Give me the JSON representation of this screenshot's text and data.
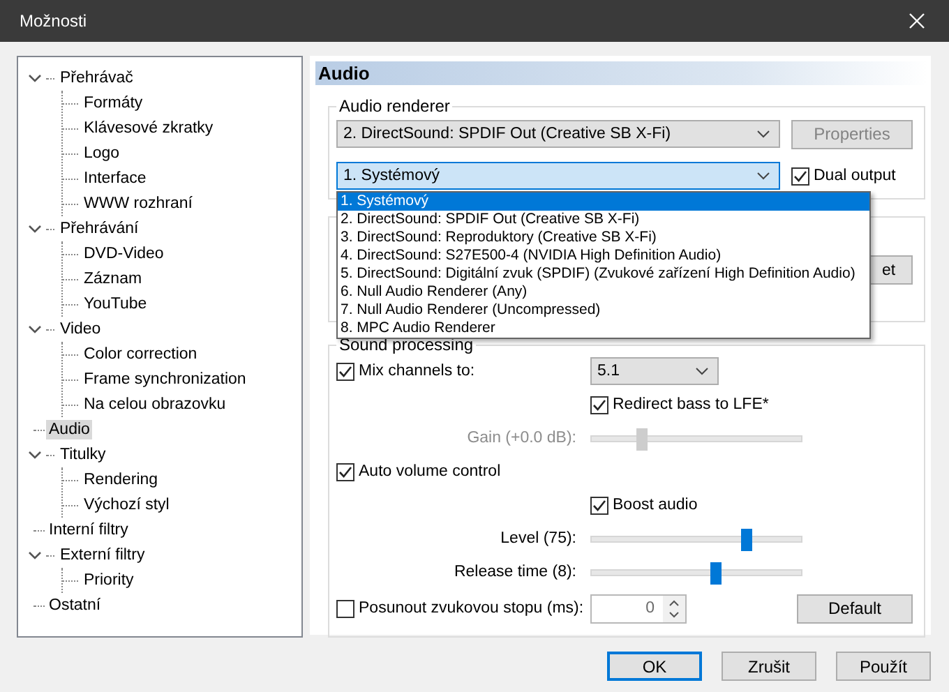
{
  "window": {
    "title": "Možnosti"
  },
  "sidebar": {
    "tree": [
      {
        "label": "Přehrávač",
        "expanded": true,
        "selected": false,
        "children": [
          {
            "label": "Formáty",
            "selected": false
          },
          {
            "label": "Klávesové zkratky",
            "selected": false
          },
          {
            "label": "Logo",
            "selected": false
          },
          {
            "label": "Interface",
            "selected": false
          },
          {
            "label": "WWW rozhraní",
            "selected": false
          }
        ]
      },
      {
        "label": "Přehrávání",
        "expanded": true,
        "selected": false,
        "children": [
          {
            "label": "DVD-Video",
            "selected": false
          },
          {
            "label": "Záznam",
            "selected": false
          },
          {
            "label": "YouTube",
            "selected": false
          }
        ]
      },
      {
        "label": "Video",
        "expanded": true,
        "selected": false,
        "children": [
          {
            "label": "Color correction",
            "selected": false
          },
          {
            "label": "Frame synchronization",
            "selected": false
          },
          {
            "label": "Na celou obrazovku",
            "selected": false
          }
        ]
      },
      {
        "label": "Audio",
        "selected": true
      },
      {
        "label": "Titulky",
        "expanded": true,
        "selected": false,
        "children": [
          {
            "label": "Rendering",
            "selected": false
          },
          {
            "label": "Výchozí styl",
            "selected": false
          }
        ]
      },
      {
        "label": "Interní filtry",
        "selected": false
      },
      {
        "label": "Externí filtry",
        "expanded": true,
        "selected": false,
        "children": [
          {
            "label": "Priority",
            "selected": false
          }
        ]
      },
      {
        "label": "Ostatní",
        "selected": false
      }
    ]
  },
  "panel": {
    "title": "Audio",
    "audio_renderer": {
      "legend": "Audio renderer",
      "renderer": "2. DirectSound: SPDIF Out (Creative SB X-Fi)",
      "properties_button": {
        "label": "Properties",
        "disabled": true
      },
      "second_output": "1. Systémový",
      "dual_output": {
        "label": "Dual output",
        "checked": true
      },
      "options": [
        {
          "label": "1. Systémový",
          "selected": true
        },
        {
          "label": "2. DirectSound: SPDIF Out (Creative SB X-Fi)",
          "selected": false
        },
        {
          "label": "3. DirectSound: Reproduktory (Creative SB X-Fi)",
          "selected": false
        },
        {
          "label": "4. DirectSound: S27E500-4 (NVIDIA High Definition Audio)",
          "selected": false
        },
        {
          "label": "5. DirectSound: Digitální zvuk (SPDIF) (Zvukové zařízení High Definition Audio)",
          "selected": false
        },
        {
          "label": "6. Null Audio Renderer (Any)",
          "selected": false
        },
        {
          "label": "7. Null Audio Renderer (Uncompressed)",
          "selected": false
        },
        {
          "label": "8. MPC Audio Renderer",
          "selected": false
        }
      ]
    },
    "covered_group": {
      "button": "et"
    },
    "sound_processing": {
      "legend": "Sound processing",
      "rows": [
        {
          "kind": "checkbox_select",
          "label": "Mix channels to:",
          "checked": true,
          "value": "5.1"
        },
        {
          "kind": "sub_checkbox",
          "label": "Redirect bass to LFE*",
          "checked": true
        },
        {
          "kind": "slider",
          "label": "Gain (+0.0 dB):",
          "level": 0.24,
          "disabled": true
        },
        {
          "kind": "checkbox",
          "label": "Auto volume control",
          "checked": true
        },
        {
          "kind": "sub_checkbox",
          "label": "Boost audio",
          "checked": true
        },
        {
          "kind": "slider",
          "label": "Level (75):",
          "level": 0.74,
          "disabled": false
        },
        {
          "kind": "slider",
          "label": "Release time (8):",
          "level": 0.59,
          "disabled": false
        },
        {
          "kind": "checkbox_spin",
          "label": "Posunout zvukovou stopu (ms):",
          "checked": false,
          "value": "0",
          "button": "Default"
        }
      ]
    }
  },
  "buttons": [
    {
      "label": "OK",
      "default": true
    },
    {
      "label": "Zrušit",
      "default": false
    },
    {
      "label": "Použít",
      "default": false
    }
  ]
}
